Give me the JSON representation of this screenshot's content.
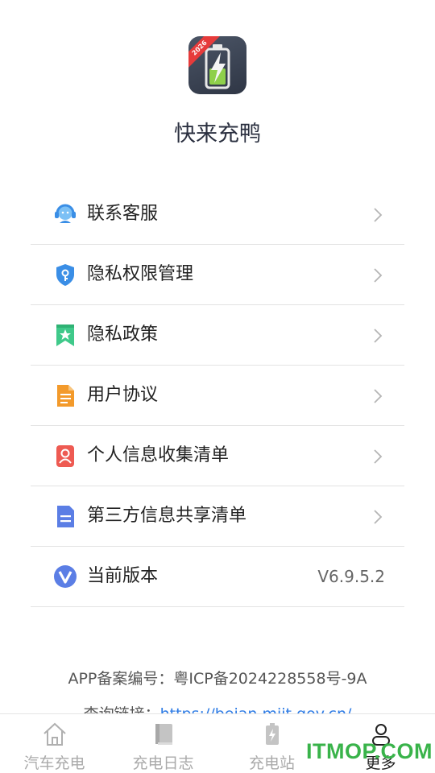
{
  "app": {
    "name": "快来充鸭",
    "logo_badge": "2026",
    "icon": "battery-charging-icon"
  },
  "menu": {
    "items": [
      {
        "label": "联系客服",
        "icon": "customer-service-icon",
        "color": "#3a8ee6"
      },
      {
        "label": "隐私权限管理",
        "icon": "privacy-shield-icon",
        "color": "#3a8ee6"
      },
      {
        "label": "隐私政策",
        "icon": "bookmark-star-icon",
        "color": "#3fc98a"
      },
      {
        "label": "用户协议",
        "icon": "document-icon",
        "color": "#f39a2b"
      },
      {
        "label": "个人信息收集清单",
        "icon": "person-card-icon",
        "color": "#ee5a52"
      },
      {
        "label": "第三方信息共享清单",
        "icon": "list-document-icon",
        "color": "#5b7ee5"
      },
      {
        "label": "当前版本",
        "icon": "version-v-icon",
        "color": "#5b7ee5",
        "value": "V6.9.5.2"
      }
    ]
  },
  "footer": {
    "icp": "APP备案编号：粤ICP备2024228558号-9A",
    "query_prefix": "查询链接：",
    "query_link": "https://beian.miit.gov.cn/"
  },
  "tabbar": {
    "tabs": [
      {
        "label": "汽车充电",
        "icon": "home-icon",
        "active": false
      },
      {
        "label": "充电日志",
        "icon": "book-icon",
        "active": false
      },
      {
        "label": "充电站",
        "icon": "battery-icon",
        "active": false
      },
      {
        "label": "更多",
        "icon": "user-icon",
        "active": true
      }
    ],
    "active_color": "#222222",
    "inactive_color": "#aaaaaa"
  },
  "watermark": {
    "text": "ITMOP.COM",
    "color": "#39b34a"
  }
}
